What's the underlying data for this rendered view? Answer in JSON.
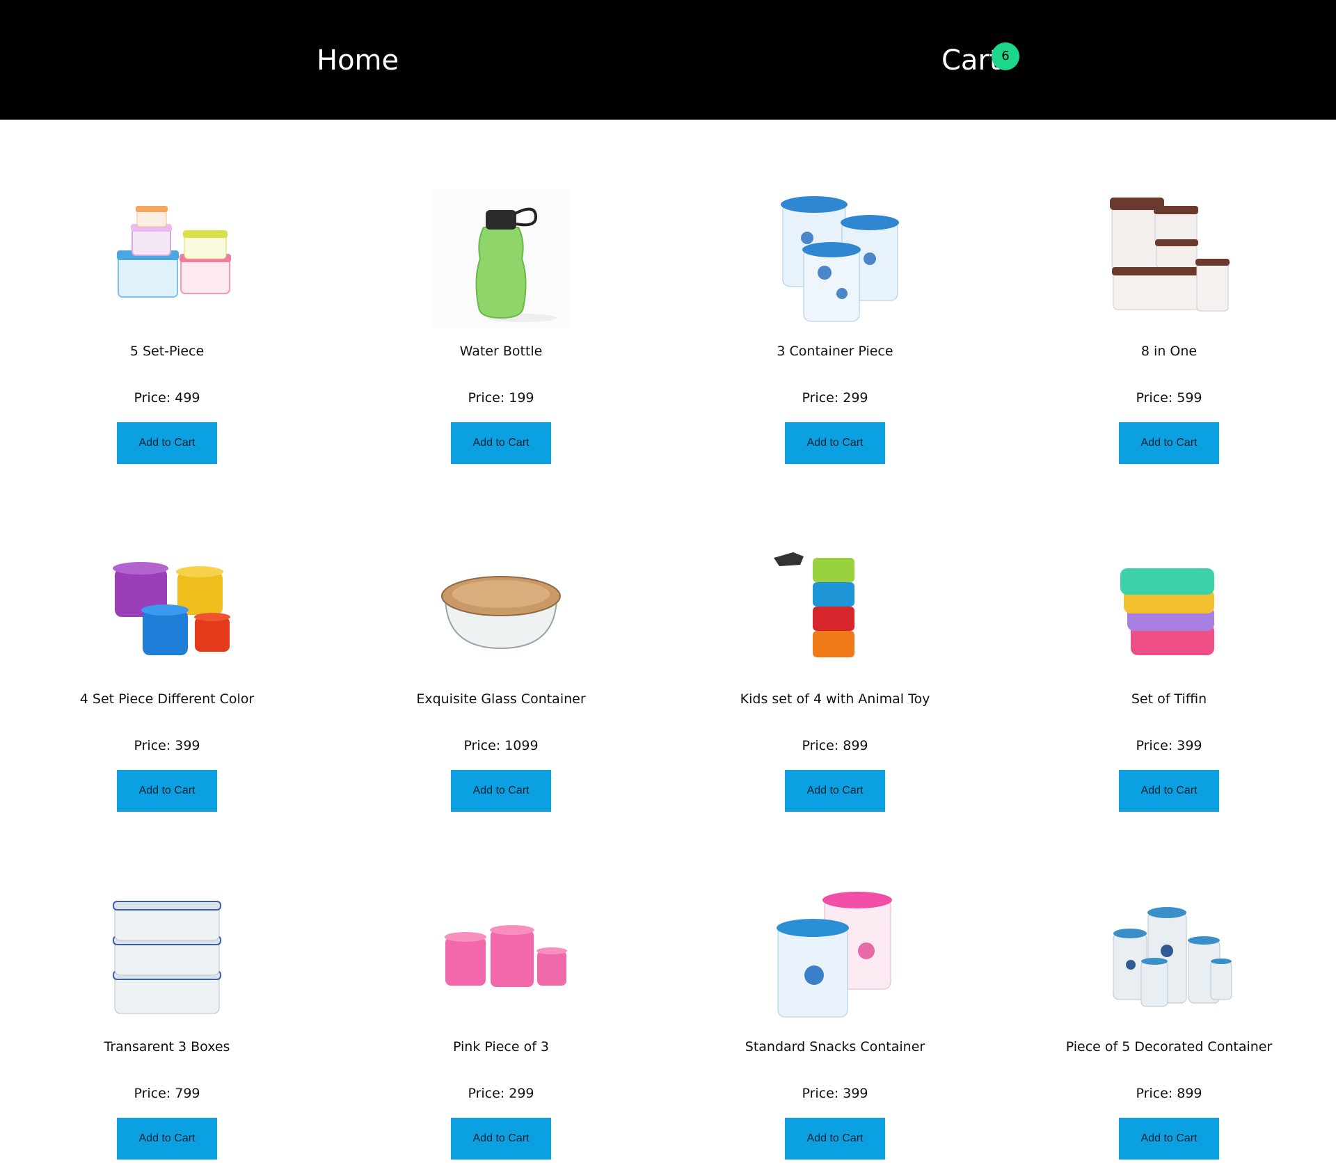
{
  "nav": {
    "home_label": "Home",
    "cart_label": "Cart",
    "cart_count": "6"
  },
  "labels": {
    "price_prefix": "Price:",
    "add_to_cart": "Add to Cart"
  },
  "colors": {
    "header_bg": "#000000",
    "badge": "#1ed68a",
    "button": "#0aa0e2"
  },
  "products": [
    {
      "name": "5 Set-Piece",
      "price": "499",
      "image": "stacked-colored-container-set-image"
    },
    {
      "name": "Water Bottle",
      "price": "199",
      "image": "green-water-bottle-image"
    },
    {
      "name": "3 Container Piece",
      "price": "299",
      "image": "blue-floral-containers-image"
    },
    {
      "name": "8 in One",
      "price": "599",
      "image": "brown-lid-containers-image"
    },
    {
      "name": "4 Set Piece Different Color",
      "price": "399",
      "image": "multicolor-round-containers-image"
    },
    {
      "name": "Exquisite Glass Container",
      "price": "1099",
      "image": "glass-container-wooden-lid-image"
    },
    {
      "name": "Kids set of 4 with Animal Toy",
      "price": "899",
      "image": "kids-stacked-containers-image"
    },
    {
      "name": "Set of Tiffin",
      "price": "399",
      "image": "stacked-tiffin-boxes-image"
    },
    {
      "name": "Transarent 3 Boxes",
      "price": "799",
      "image": "transparent-stacked-boxes-image"
    },
    {
      "name": "Pink Piece of 3",
      "price": "299",
      "image": "pink-containers-image"
    },
    {
      "name": "Standard Snacks Container",
      "price": "399",
      "image": "floral-snack-containers-image"
    },
    {
      "name": "Piece of 5 Decorated Container",
      "price": "899",
      "image": "decorated-containers-image"
    }
  ]
}
